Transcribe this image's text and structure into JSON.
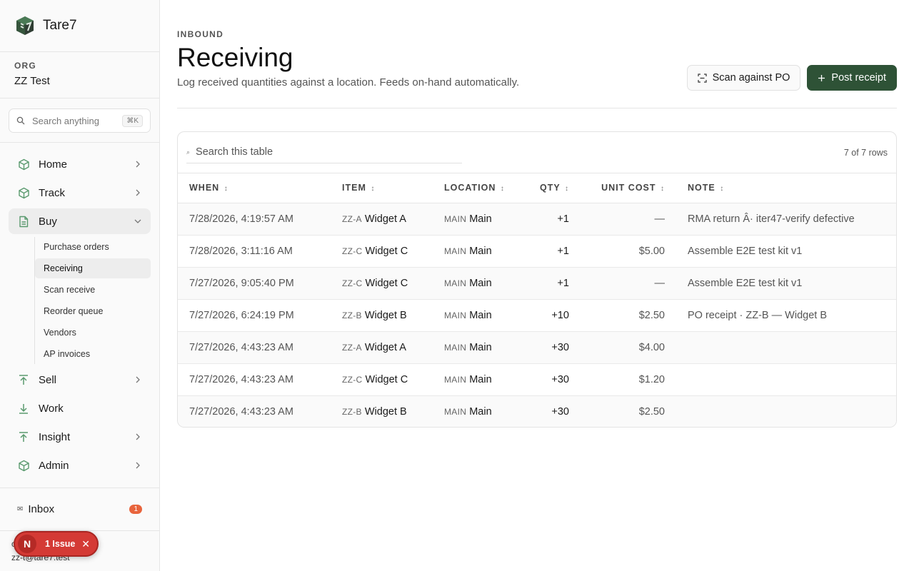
{
  "brand": {
    "name": "Tare7"
  },
  "org": {
    "label": "ORG",
    "name": "ZZ Test"
  },
  "search": {
    "placeholder": "Search anything",
    "shortcut": "⌘K"
  },
  "nav": {
    "home": "Home",
    "track": "Track",
    "buy": "Buy",
    "buy_sub": [
      "Purchase orders",
      "Receiving",
      "Scan receive",
      "Reorder queue",
      "Vendors",
      "AP invoices"
    ],
    "sell": "Sell",
    "work": "Work",
    "insight": "Insight",
    "admin": "Admin"
  },
  "inbox": {
    "label": "Inbox",
    "count": "1"
  },
  "user": {
    "initial_line": "c",
    "email": "zz-t@tare7.test"
  },
  "issues": {
    "avatar": "N",
    "label": "1 Issue",
    "close": "✕"
  },
  "page": {
    "eyebrow": "INBOUND",
    "title": "Receiving",
    "subtitle": "Log received quantities against a location. Feeds on-hand automatically.",
    "scan_button": "Scan against PO",
    "post_button": "Post receipt"
  },
  "table": {
    "search_placeholder": "Search this table",
    "row_count": "7 of 7 rows",
    "columns": [
      "WHEN",
      "ITEM",
      "LOCATION",
      "QTY",
      "UNIT COST",
      "NOTE"
    ],
    "sort_glyph": "↕",
    "rows": [
      {
        "when": "7/28/2026, 4:19:57 AM",
        "sku": "ZZ-A",
        "item": "Widget A",
        "loc_code": "MAIN",
        "loc": "Main",
        "qty": "+1",
        "cost": "—",
        "note": "RMA return Â· iter47-verify defective"
      },
      {
        "when": "7/28/2026, 3:11:16 AM",
        "sku": "ZZ-C",
        "item": "Widget C",
        "loc_code": "MAIN",
        "loc": "Main",
        "qty": "+1",
        "cost": "$5.00",
        "note": "Assemble E2E test kit v1"
      },
      {
        "when": "7/27/2026, 9:05:40 PM",
        "sku": "ZZ-C",
        "item": "Widget C",
        "loc_code": "MAIN",
        "loc": "Main",
        "qty": "+1",
        "cost": "—",
        "note": "Assemble E2E test kit v1"
      },
      {
        "when": "7/27/2026, 6:24:19 PM",
        "sku": "ZZ-B",
        "item": "Widget B",
        "loc_code": "MAIN",
        "loc": "Main",
        "qty": "+10",
        "cost": "$2.50",
        "note": "PO receipt · ZZ-B — Widget B"
      },
      {
        "when": "7/27/2026, 4:43:23 AM",
        "sku": "ZZ-A",
        "item": "Widget A",
        "loc_code": "MAIN",
        "loc": "Main",
        "qty": "+30",
        "cost": "$4.00",
        "note": ""
      },
      {
        "when": "7/27/2026, 4:43:23 AM",
        "sku": "ZZ-C",
        "item": "Widget C",
        "loc_code": "MAIN",
        "loc": "Main",
        "qty": "+30",
        "cost": "$1.20",
        "note": ""
      },
      {
        "when": "7/27/2026, 4:43:23 AM",
        "sku": "ZZ-B",
        "item": "Widget B",
        "loc_code": "MAIN",
        "loc": "Main",
        "qty": "+30",
        "cost": "$2.50",
        "note": ""
      }
    ]
  },
  "colors": {
    "accent": "#2e5236",
    "badge": "#e8643c",
    "issue": "#d43a35",
    "icon_green": "#5a9a6e"
  }
}
